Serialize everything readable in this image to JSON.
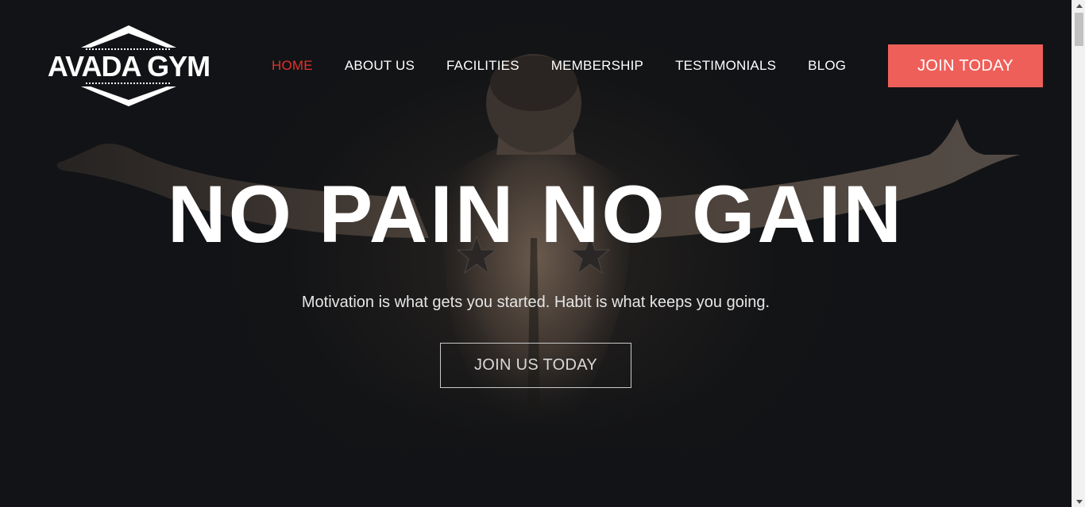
{
  "brand": {
    "logo_text": "AVADA GYM"
  },
  "nav": {
    "items": [
      {
        "label": "HOME",
        "active": true
      },
      {
        "label": "ABOUT US",
        "active": false
      },
      {
        "label": "FACILITIES",
        "active": false
      },
      {
        "label": "MEMBERSHIP",
        "active": false
      },
      {
        "label": "TESTIMONIALS",
        "active": false
      },
      {
        "label": "BLOG",
        "active": false
      }
    ],
    "cta_label": "JOIN TODAY"
  },
  "hero": {
    "title": "NO PAIN NO GAIN",
    "subtitle": "Motivation is what gets you started. Habit is what keeps you going.",
    "button_label": "JOIN US TODAY",
    "background_image": "athlete-back-silhouette"
  },
  "colors": {
    "background": "#121316",
    "accent": "#ef5f5a",
    "active_nav": "#e2322b",
    "text": "#ffffff"
  },
  "scrollbar": {
    "up_icon": "chevron-up-icon",
    "down_icon": "chevron-down-icon"
  }
}
